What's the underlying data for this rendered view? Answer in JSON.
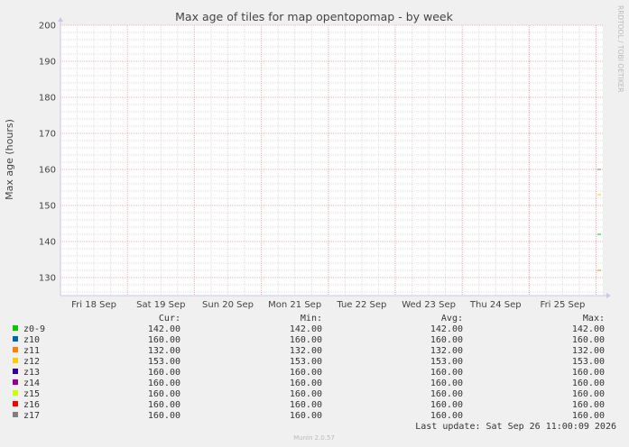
{
  "chart_data": {
    "type": "line",
    "title": "Max age of tiles for map opentopomap - by week",
    "ylabel": "Max age (hours)",
    "ylim": [
      125,
      200
    ],
    "yticks": [
      130,
      140,
      150,
      160,
      170,
      180,
      190,
      200
    ],
    "xlim": [
      0,
      8.1
    ],
    "xtick_labels": [
      "Fri 18 Sep",
      "Sat 19 Sep",
      "Sun 20 Sep",
      "Mon 21 Sep",
      "Tue 22 Sep",
      "Wed 23 Sep",
      "Thu 24 Sep",
      "Fri 25 Sep"
    ],
    "grid": true,
    "legend_placement": "bottom",
    "side_label": "RRDTOOL / TOBI OETIKER",
    "columns": [
      "Cur:",
      "Min:",
      "Avg:",
      "Max:"
    ],
    "series": [
      {
        "name": "z0-9",
        "color": "#00cc00",
        "cur": "142.00",
        "min": "142.00",
        "avg": "142.00",
        "max": "142.00",
        "value": 142
      },
      {
        "name": "z10",
        "color": "#0066b3",
        "cur": "160.00",
        "min": "160.00",
        "avg": "160.00",
        "max": "160.00",
        "value": 160
      },
      {
        "name": "z11",
        "color": "#ff8000",
        "cur": "132.00",
        "min": "132.00",
        "avg": "132.00",
        "max": "132.00",
        "value": 132
      },
      {
        "name": "z12",
        "color": "#ffcc00",
        "cur": "153.00",
        "min": "153.00",
        "avg": "153.00",
        "max": "153.00",
        "value": 153
      },
      {
        "name": "z13",
        "color": "#330099",
        "cur": "160.00",
        "min": "160.00",
        "avg": "160.00",
        "max": "160.00",
        "value": 160
      },
      {
        "name": "z14",
        "color": "#990099",
        "cur": "160.00",
        "min": "160.00",
        "avg": "160.00",
        "max": "160.00",
        "value": 160
      },
      {
        "name": "z15",
        "color": "#ccff00",
        "cur": "160.00",
        "min": "160.00",
        "avg": "160.00",
        "max": "160.00",
        "value": 160
      },
      {
        "name": "z16",
        "color": "#ff0000",
        "cur": "160.00",
        "min": "160.00",
        "avg": "160.00",
        "max": "160.00",
        "value": 160
      },
      {
        "name": "z17",
        "color": "#808080",
        "cur": "160.00",
        "min": "160.00",
        "avg": "160.00",
        "max": "160.00",
        "value": 160
      }
    ],
    "last_update": "Last update: Sat Sep 26 11:00:09 2026",
    "footer": "Munin 2.0.57"
  }
}
